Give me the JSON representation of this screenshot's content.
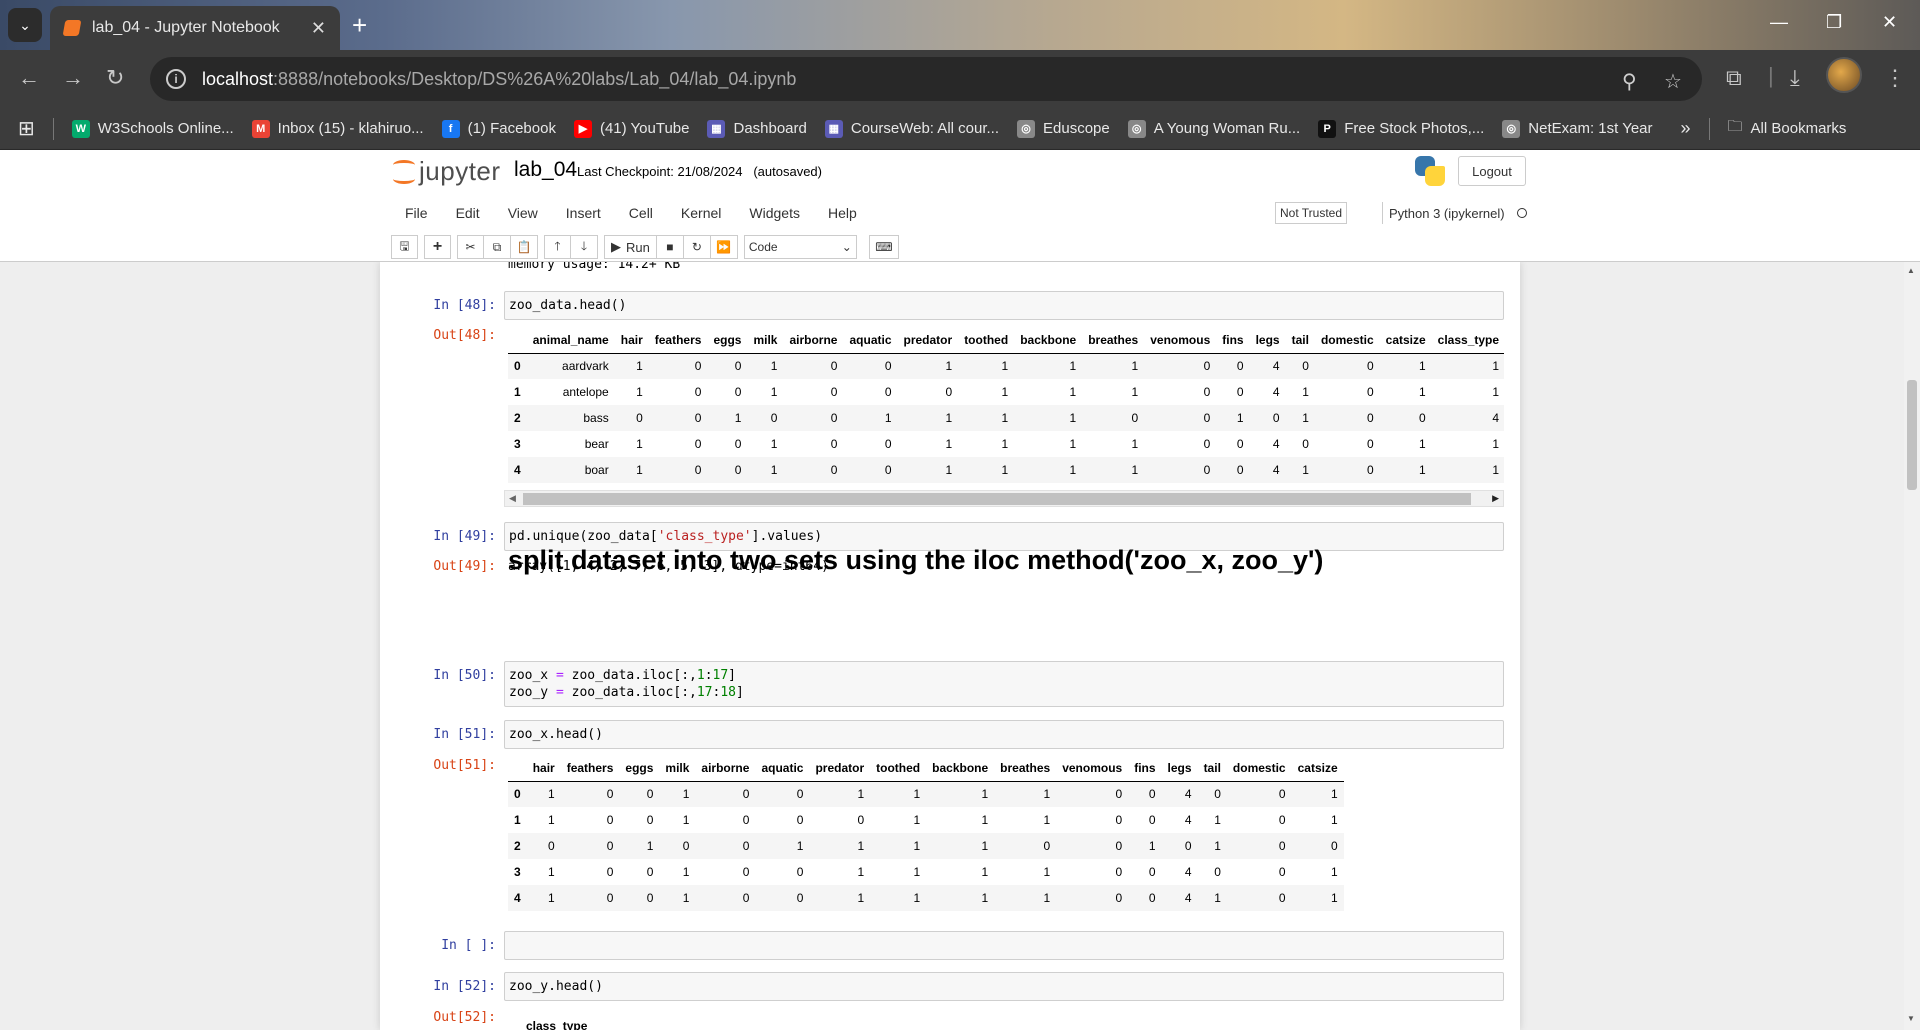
{
  "browser": {
    "tab_title": "lab_04 - Jupyter Notebook",
    "url_host": "localhost",
    "url_path": ":8888/notebooks/Desktop/DS%26A%20labs/Lab_04/lab_04.ipynb",
    "bookmarks": [
      {
        "label": "W3Schools Online...",
        "icon": "w3schools-icon",
        "color": "#04aa6d",
        "glyph": "W"
      },
      {
        "label": "Inbox (15) - klahiruo...",
        "icon": "gmail-icon",
        "color": "#ea4335",
        "glyph": "M"
      },
      {
        "label": "(1) Facebook",
        "icon": "facebook-icon",
        "color": "#1877f2",
        "glyph": "f"
      },
      {
        "label": "(41) YouTube",
        "icon": "youtube-icon",
        "color": "#ff0000",
        "glyph": "▶"
      },
      {
        "label": "Dashboard",
        "icon": "university-icon",
        "color": "#5b5bb5",
        "glyph": "▦"
      },
      {
        "label": "CourseWeb: All cour...",
        "icon": "university-icon",
        "color": "#5b5bb5",
        "glyph": "▦"
      },
      {
        "label": "Eduscope",
        "icon": "globe-icon",
        "color": "#888888",
        "glyph": "◎"
      },
      {
        "label": "A Young Woman Ru...",
        "icon": "globe-icon",
        "color": "#888888",
        "glyph": "◎"
      },
      {
        "label": "Free Stock Photos,...",
        "icon": "pexels-icon",
        "color": "#111111",
        "glyph": "P"
      },
      {
        "label": "NetExam: 1st Year",
        "icon": "globe-icon",
        "color": "#888888",
        "glyph": "◎"
      }
    ],
    "more_bookmarks": "»",
    "all_bookmarks": "All Bookmarks"
  },
  "jupyter": {
    "logo_text": "jupyter",
    "notebook_name": "lab_04",
    "checkpoint": "Last Checkpoint: 21/08/2024   (autosaved)",
    "logout": "Logout",
    "menu": [
      "File",
      "Edit",
      "View",
      "Insert",
      "Cell",
      "Kernel",
      "Widgets",
      "Help"
    ],
    "trusted": "Not Trusted",
    "kernel": "Python 3 (ipykernel)",
    "run_label": "Run",
    "cell_type": "Code"
  },
  "notebook": {
    "partial_output": "memory usage: 14.2+ KB",
    "cells": [
      {
        "in": "In [48]:",
        "code": "zoo_data.head()",
        "out": "Out[48]:"
      },
      {
        "in": "In [49]:",
        "code_parts": [
          "pd.unique(zoo_data[",
          "'class_type'",
          "].values)"
        ],
        "out": "Out[49]:",
        "out_text": "array([1, 4, 2, 7, 6, 5, 3], dtype=int64)"
      },
      {
        "in": "In [50]:",
        "line1": [
          "zoo_x ",
          "=",
          " zoo_data.iloc[:,",
          "1",
          ":",
          "17",
          "]"
        ],
        "line2": [
          "zoo_y ",
          "=",
          " zoo_data.iloc[:,",
          "17",
          ":",
          "18",
          "]"
        ]
      },
      {
        "in": "In [51]:",
        "code": "zoo_x.head()",
        "out": "Out[51]:"
      },
      {
        "in": "In [ ]:",
        "code": ""
      },
      {
        "in": "In [52]:",
        "code": "zoo_y.head()",
        "out": "Out[52]:"
      }
    ],
    "heading": "split dataset into two sets using the iloc method('zoo_x, zoo_y')",
    "df_full": {
      "columns": [
        "animal_name",
        "hair",
        "feathers",
        "eggs",
        "milk",
        "airborne",
        "aquatic",
        "predator",
        "toothed",
        "backbone",
        "breathes",
        "venomous",
        "fins",
        "legs",
        "tail",
        "domestic",
        "catsize",
        "class_type"
      ],
      "rows": [
        [
          "0",
          "aardvark",
          "1",
          "0",
          "0",
          "1",
          "0",
          "0",
          "1",
          "1",
          "1",
          "1",
          "0",
          "0",
          "4",
          "0",
          "0",
          "1",
          "1"
        ],
        [
          "1",
          "antelope",
          "1",
          "0",
          "0",
          "1",
          "0",
          "0",
          "0",
          "1",
          "1",
          "1",
          "0",
          "0",
          "4",
          "1",
          "0",
          "1",
          "1"
        ],
        [
          "2",
          "bass",
          "0",
          "0",
          "1",
          "0",
          "0",
          "1",
          "1",
          "1",
          "1",
          "0",
          "0",
          "1",
          "0",
          "1",
          "0",
          "0",
          "4"
        ],
        [
          "3",
          "bear",
          "1",
          "0",
          "0",
          "1",
          "0",
          "0",
          "1",
          "1",
          "1",
          "1",
          "0",
          "0",
          "4",
          "0",
          "0",
          "1",
          "1"
        ],
        [
          "4",
          "boar",
          "1",
          "0",
          "0",
          "1",
          "0",
          "0",
          "1",
          "1",
          "1",
          "1",
          "0",
          "0",
          "4",
          "1",
          "0",
          "1",
          "1"
        ]
      ]
    },
    "df_x": {
      "columns": [
        "hair",
        "feathers",
        "eggs",
        "milk",
        "airborne",
        "aquatic",
        "predator",
        "toothed",
        "backbone",
        "breathes",
        "venomous",
        "fins",
        "legs",
        "tail",
        "domestic",
        "catsize"
      ],
      "rows": [
        [
          "0",
          "1",
          "0",
          "0",
          "1",
          "0",
          "0",
          "1",
          "1",
          "1",
          "1",
          "0",
          "0",
          "4",
          "0",
          "0",
          "1"
        ],
        [
          "1",
          "1",
          "0",
          "0",
          "1",
          "0",
          "0",
          "0",
          "1",
          "1",
          "1",
          "0",
          "0",
          "4",
          "1",
          "0",
          "1"
        ],
        [
          "2",
          "0",
          "0",
          "1",
          "0",
          "0",
          "1",
          "1",
          "1",
          "1",
          "0",
          "0",
          "1",
          "0",
          "1",
          "0",
          "0"
        ],
        [
          "3",
          "1",
          "0",
          "0",
          "1",
          "0",
          "0",
          "1",
          "1",
          "1",
          "1",
          "0",
          "0",
          "4",
          "0",
          "0",
          "1"
        ],
        [
          "4",
          "1",
          "0",
          "0",
          "1",
          "0",
          "0",
          "1",
          "1",
          "1",
          "1",
          "0",
          "0",
          "4",
          "1",
          "0",
          "1"
        ]
      ]
    },
    "df_y": {
      "columns": [
        "class_type"
      ]
    }
  }
}
